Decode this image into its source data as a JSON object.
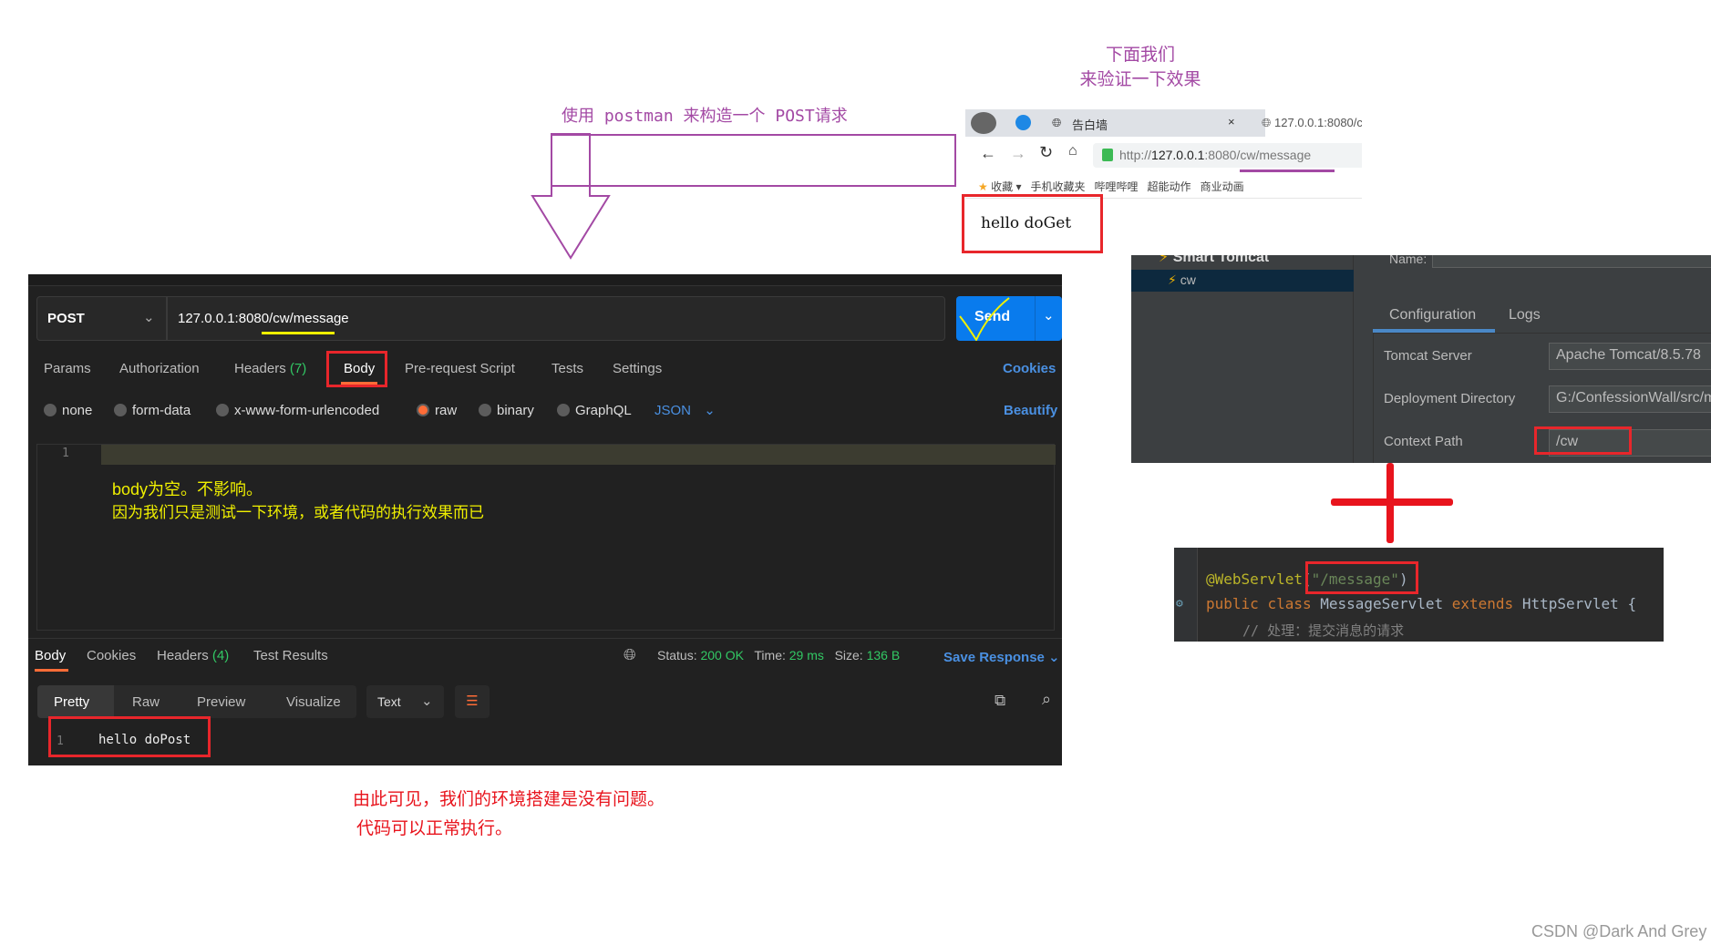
{
  "annotations": {
    "postman_note": "使用 postman 来构造一个 POST请求",
    "verify_line1": "下面我们",
    "verify_line2": "来验证一下效果",
    "body_note_line1": "body为空。不影响。",
    "body_note_line2": "因为我们只是测试一下环境，或者代码的执行效果而已",
    "conclusion_line1": "由此可见，我们的环境搭建是没有问题。",
    "conclusion_line2": "代码可以正常执行。",
    "watermark": "CSDN @Dark And Grey"
  },
  "postman": {
    "method": "POST",
    "url": "127.0.0.1:8080/cw/message",
    "send_label": "Send",
    "tabs": [
      {
        "label": "Params"
      },
      {
        "label": "Authorization"
      },
      {
        "label": "Headers",
        "count": "(7)"
      },
      {
        "label": "Body"
      },
      {
        "label": "Pre-request Script"
      },
      {
        "label": "Tests"
      },
      {
        "label": "Settings"
      }
    ],
    "cookies_label": "Cookies",
    "body_types": [
      "none",
      "form-data",
      "x-www-form-urlencoded",
      "raw",
      "binary",
      "GraphQL"
    ],
    "selected_body_type": "raw",
    "format": "JSON",
    "beautify_label": "Beautify",
    "editor_line": "1",
    "response_tabs": [
      {
        "label": "Body"
      },
      {
        "label": "Cookies"
      },
      {
        "label": "Headers",
        "count": "(4)"
      },
      {
        "label": "Test Results"
      }
    ],
    "status_label": "Status:",
    "status_value": "200 OK",
    "time_label": "Time:",
    "time_value": "29 ms",
    "size_label": "Size:",
    "size_value": "136 B",
    "save_response_label": "Save Response",
    "view_modes": [
      "Pretty",
      "Raw",
      "Preview",
      "Visualize"
    ],
    "text_format": "Text",
    "response_line_no": "1",
    "response_text": "hello doPost",
    "accent": "#ff6c37"
  },
  "browser": {
    "tab1_title": "告白墙",
    "tab2_title": "127.0.0.1:8080/c",
    "address_scheme": "http://",
    "address_host": "127.0.0.1",
    "address_rest": ":8080/cw/message",
    "bookmarks": [
      "收藏",
      "手机收藏夹",
      "哔哩哔哩",
      "超能动作",
      "商业动画"
    ],
    "content": "hello doGet"
  },
  "ide": {
    "tree_root": "Smart Tomcat",
    "tree_item": "cw",
    "tabs": [
      "Configuration",
      "Logs"
    ],
    "fields": [
      {
        "label": "Tomcat Server",
        "value": "Apache Tomcat/8.5.78"
      },
      {
        "label": "Deployment Directory",
        "value": "G:/ConfessionWall/src/main/webapp"
      },
      {
        "label": "Context Path",
        "value": "/cw"
      }
    ]
  },
  "code": {
    "annotation": "@WebServlet",
    "annotation_arg_open": "(",
    "annotation_arg": "\"/message\"",
    "annotation_arg_close": ")",
    "kw_public": "public",
    "kw_class": "class",
    "class_name": "MessageServlet",
    "kw_extends": "extends",
    "super_name": "HttpServlet",
    "brace": "{",
    "comment": "// 处理：提交消息的请求"
  }
}
